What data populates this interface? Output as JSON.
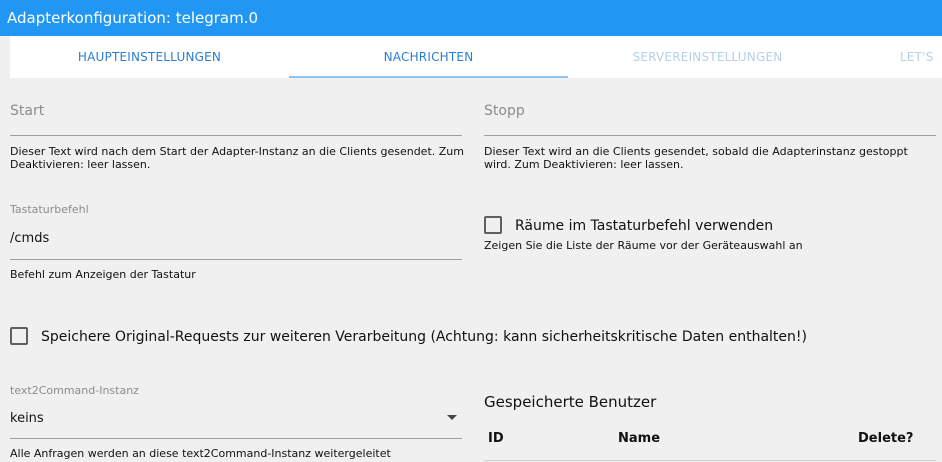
{
  "window": {
    "title": "Adapterkonfiguration: telegram.0"
  },
  "tabs": [
    {
      "label": "HAUPTEINSTELLUNGEN",
      "state": "normal"
    },
    {
      "label": "NACHRICHTEN",
      "state": "active"
    },
    {
      "label": "SERVEREINSTELLUNGEN",
      "state": "disabled"
    },
    {
      "label": "LET'S E",
      "state": "disabled"
    }
  ],
  "start": {
    "label": "Start",
    "value": "",
    "helper": "Dieser Text wird nach dem Start der Adapter-Instanz an die Clients gesendet. Zum Deaktivieren: leer lassen."
  },
  "stop": {
    "label": "Stopp",
    "value": "",
    "helper": "Dieser Text wird an die Clients gesendet, sobald die Adapterinstanz gestoppt wird. Zum Deaktivieren: leer lassen."
  },
  "keyboard": {
    "label": "Tastaturbefehl",
    "value": "/cmds",
    "helper": "Befehl zum Anzeigen der Tastatur"
  },
  "rooms": {
    "label": "Räume im Tastaturbefehl verwenden",
    "checked": false,
    "helper": "Zeigen Sie die Liste der Räume vor der Geräteauswahl an"
  },
  "save_requests": {
    "label": "Speichere Original-Requests zur weiteren Verarbeitung (Achtung: kann sicherheitskritische Daten enthalten!)",
    "checked": false
  },
  "text2command": {
    "label": "text2Command-Instanz",
    "value": "keins",
    "helper": "Alle Anfragen werden an diese text2Command-Instanz weitergeleitet"
  },
  "users": {
    "title": "Gespeicherte Benutzer",
    "columns": [
      "ID",
      "Name",
      "Delete?"
    ]
  },
  "colors": {
    "accent": "#2196f3",
    "tab_text": "#2a7ed6",
    "tab_disabled": "#b5d0ea"
  }
}
